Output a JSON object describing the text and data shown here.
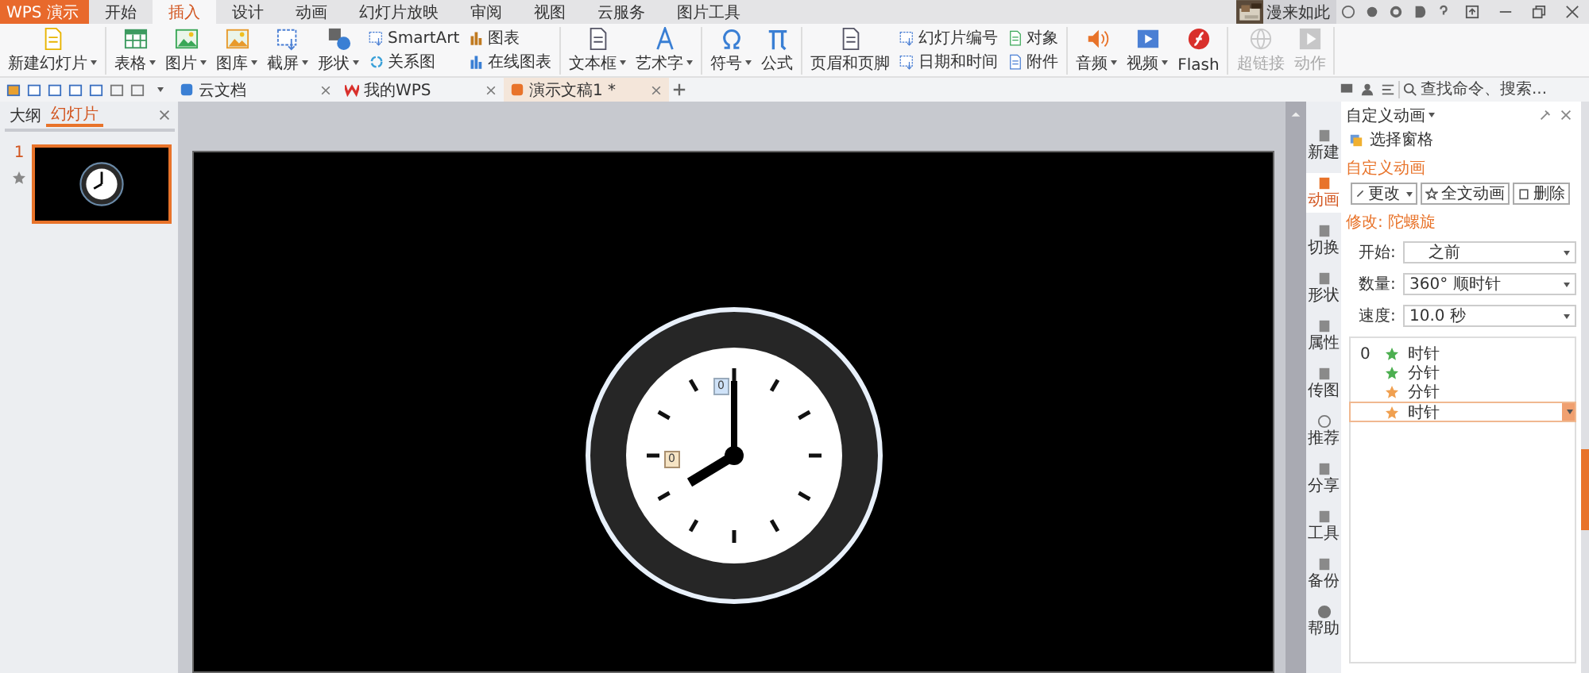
{
  "app_menu": {
    "label": "WPS 演示"
  },
  "menu_tabs": [
    {
      "label": "开始",
      "selected": false
    },
    {
      "label": "插入",
      "selected": true
    },
    {
      "label": "设计",
      "selected": false
    },
    {
      "label": "动画",
      "selected": false
    },
    {
      "label": "幻灯片放映",
      "selected": false
    },
    {
      "label": "审阅",
      "selected": false
    },
    {
      "label": "视图",
      "selected": false
    },
    {
      "label": "云服务",
      "selected": false
    },
    {
      "label": "图片工具",
      "selected": false
    }
  ],
  "user": {
    "name": "漫来如此"
  },
  "ribbon": [
    [
      {
        "kind": "large",
        "items": [
          {
            "label": "新建幻灯片",
            "dropdown": true,
            "disabled": false
          }
        ]
      }
    ],
    [
      {
        "kind": "large",
        "items": [
          {
            "label": "表格",
            "dropdown": true,
            "disabled": false
          },
          {
            "label": "图片",
            "dropdown": true,
            "disabled": false
          },
          {
            "label": "图库",
            "dropdown": true,
            "disabled": false
          },
          {
            "label": "截屏",
            "dropdown": true,
            "disabled": false
          },
          {
            "label": "形状",
            "dropdown": true,
            "disabled": false
          }
        ]
      },
      {
        "kind": "stack",
        "items": [
          {
            "label": "SmartArt",
            "dropdown": false,
            "disabled": false
          },
          {
            "label": "关系图",
            "dropdown": false,
            "disabled": false
          }
        ]
      },
      {
        "kind": "stack",
        "items": [
          {
            "label": "图表",
            "dropdown": false,
            "disabled": false
          },
          {
            "label": "在线图表",
            "dropdown": false,
            "disabled": false
          }
        ]
      }
    ],
    [
      {
        "kind": "large",
        "items": [
          {
            "label": "文本框",
            "dropdown": true,
            "disabled": false
          },
          {
            "label": "艺术字",
            "dropdown": true,
            "disabled": false
          }
        ]
      }
    ],
    [
      {
        "kind": "large",
        "items": [
          {
            "label": "符号",
            "dropdown": true,
            "disabled": false
          },
          {
            "label": "公式",
            "dropdown": false,
            "disabled": false
          }
        ]
      }
    ],
    [
      {
        "kind": "large",
        "items": [
          {
            "label": "页眉和页脚",
            "dropdown": false,
            "disabled": false
          }
        ]
      },
      {
        "kind": "stack",
        "items": [
          {
            "label": "幻灯片编号",
            "dropdown": false,
            "disabled": false
          },
          {
            "label": "日期和时间",
            "dropdown": false,
            "disabled": false
          }
        ]
      },
      {
        "kind": "stack",
        "items": [
          {
            "label": "对象",
            "dropdown": false,
            "disabled": false
          },
          {
            "label": "附件",
            "dropdown": false,
            "disabled": false
          }
        ]
      }
    ],
    [
      {
        "kind": "large",
        "items": [
          {
            "label": "音频",
            "dropdown": true,
            "disabled": false
          },
          {
            "label": "视频",
            "dropdown": true,
            "disabled": false
          },
          {
            "label": "Flash",
            "dropdown": false,
            "disabled": false
          }
        ]
      }
    ],
    [
      {
        "kind": "large",
        "items": [
          {
            "label": "超链接",
            "dropdown": false,
            "disabled": true
          },
          {
            "label": "动作",
            "dropdown": false,
            "disabled": true
          }
        ]
      }
    ]
  ],
  "doc_tabs": [
    {
      "label": "云文档",
      "selected": false
    },
    {
      "label": "我的WPS",
      "selected": false
    },
    {
      "label": "演示文稿1 *",
      "selected": true
    }
  ],
  "search": {
    "placeholder": "查找命令、搜索..."
  },
  "left_panel": {
    "tabs": [
      {
        "label": "大纲",
        "selected": false
      },
      {
        "label": "幻灯片",
        "selected": true
      }
    ],
    "slides": [
      {
        "number": "1",
        "selected": true
      }
    ]
  },
  "slide": {
    "markers": [
      {
        "label": "0",
        "color": "#cfe2f8"
      },
      {
        "label": "0",
        "color": "#f6e4c4"
      }
    ]
  },
  "sidebar": [
    {
      "label": "新建",
      "selected": false
    },
    {
      "label": "动画",
      "selected": true
    },
    {
      "label": "切换",
      "selected": false
    },
    {
      "label": "形状",
      "selected": false
    },
    {
      "label": "属性",
      "selected": false
    },
    {
      "label": "传图",
      "selected": false
    },
    {
      "label": "推荐",
      "selected": false
    },
    {
      "label": "分享",
      "selected": false
    },
    {
      "label": "工具",
      "selected": false
    },
    {
      "label": "备份",
      "selected": false
    },
    {
      "label": "帮助",
      "selected": false
    }
  ],
  "panel": {
    "title": "自定义动画",
    "selection_pane": "选择窗格",
    "section": "自定义动画",
    "buttons": [
      {
        "label": "更改"
      },
      {
        "label": "全文动画"
      },
      {
        "label": "删除"
      }
    ],
    "modify": "修改: 陀螺旋",
    "fields": [
      {
        "label": "开始:",
        "value": "之前"
      },
      {
        "label": "数量:",
        "value": "360° 顺时针"
      },
      {
        "label": "速度:",
        "value": "10.0 秒"
      }
    ],
    "animations": [
      {
        "order": "0",
        "label": "时针",
        "color": "#4caf50",
        "selected": false
      },
      {
        "label": "分针",
        "color": "#4caf50",
        "selected": false
      },
      {
        "label": "分针",
        "color": "#f0a050",
        "selected": false
      },
      {
        "label": "时针",
        "color": "#f0a050",
        "selected": true
      }
    ]
  }
}
